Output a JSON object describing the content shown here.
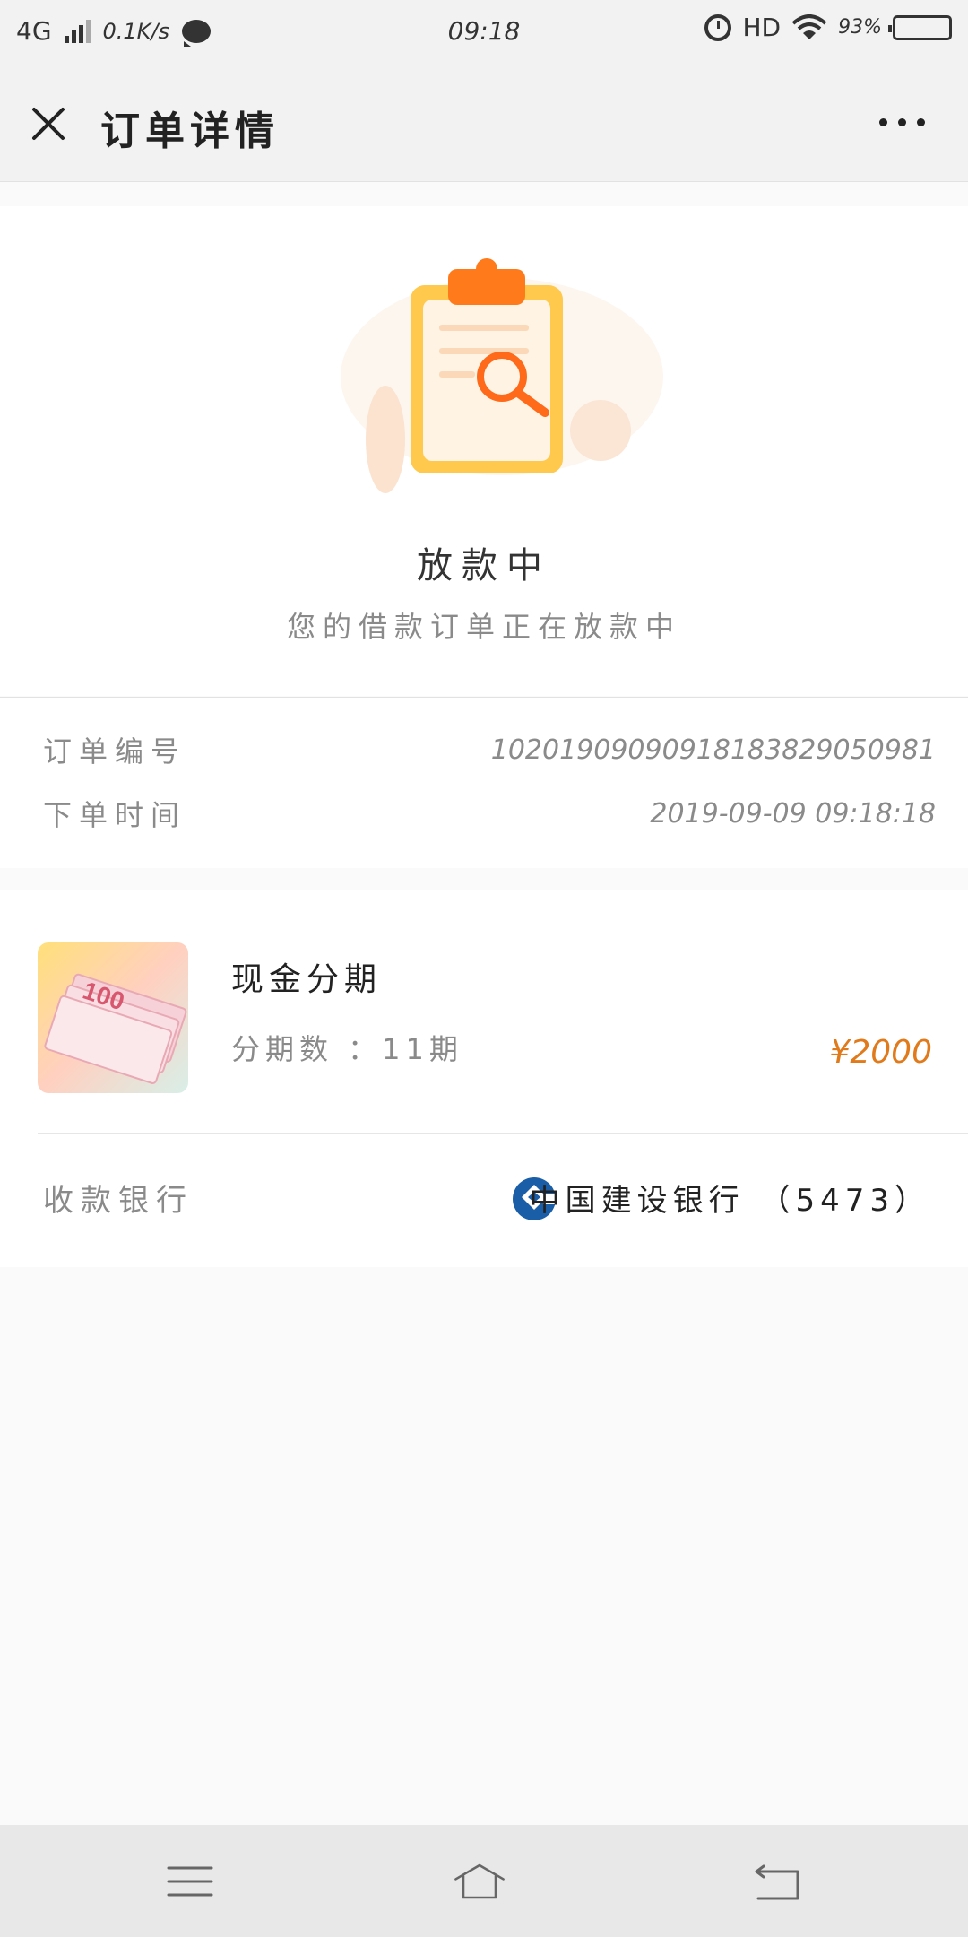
{
  "status_bar": {
    "network": "4G",
    "net_speed": "0.1K/s",
    "time": "09:18",
    "hd": "HD",
    "battery": "93%"
  },
  "header": {
    "title": "订单详情"
  },
  "status": {
    "title": "放款中",
    "subtitle": "您的借款订单正在放款中"
  },
  "order": {
    "number_label": "订单编号",
    "number_value": "10201909090918183829050981",
    "time_label": "下单时间",
    "time_value": "2019-09-09 09:18:18"
  },
  "product": {
    "name": "现金分期",
    "installments": "分期数 ：11期",
    "amount": "¥2000",
    "bank_label": "收款银行",
    "bank_name": "中国建设银行 （5473）"
  },
  "colors": {
    "accent_orange": "#e07a1a",
    "bank_blue": "#1a5ea8"
  },
  "icons": {
    "close": "close-icon",
    "more": "more-icon",
    "bank": "ccb-logo-icon",
    "nav_menu": "menu-icon",
    "nav_home": "home-icon",
    "nav_back": "back-icon"
  }
}
